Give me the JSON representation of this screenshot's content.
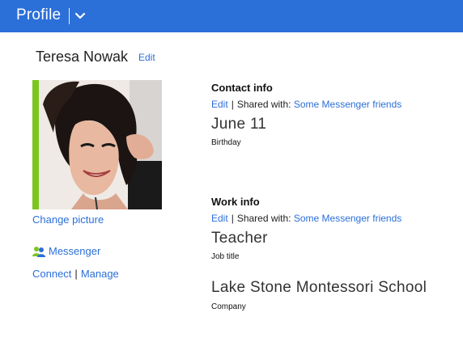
{
  "header": {
    "title": "Profile",
    "menu_icon": "chevron-down-icon",
    "bg_color": "#2b6fd9"
  },
  "profile": {
    "name": "Teresa Nowak",
    "edit_label": "Edit"
  },
  "left": {
    "change_picture": "Change picture",
    "messenger_label": "Messenger",
    "connect_label": "Connect",
    "separator": "|",
    "manage_label": "Manage"
  },
  "contact": {
    "title": "Contact info",
    "edit_label": "Edit",
    "separator": "|",
    "shared_with_label": "Shared with:",
    "shared_with_value": "Some Messenger friends",
    "birthday_value": "June 11",
    "birthday_label": "Birthday"
  },
  "work": {
    "title": "Work info",
    "edit_label": "Edit",
    "separator": "|",
    "shared_with_label": "Shared with:",
    "shared_with_value": "Some Messenger friends",
    "job_title_value": "Teacher",
    "job_title_label": "Job title",
    "company_value": "Lake Stone Montessori School",
    "company_label": "Company"
  },
  "colors": {
    "accent": "#2b6fd9",
    "photo_border": "#7cc51f"
  }
}
